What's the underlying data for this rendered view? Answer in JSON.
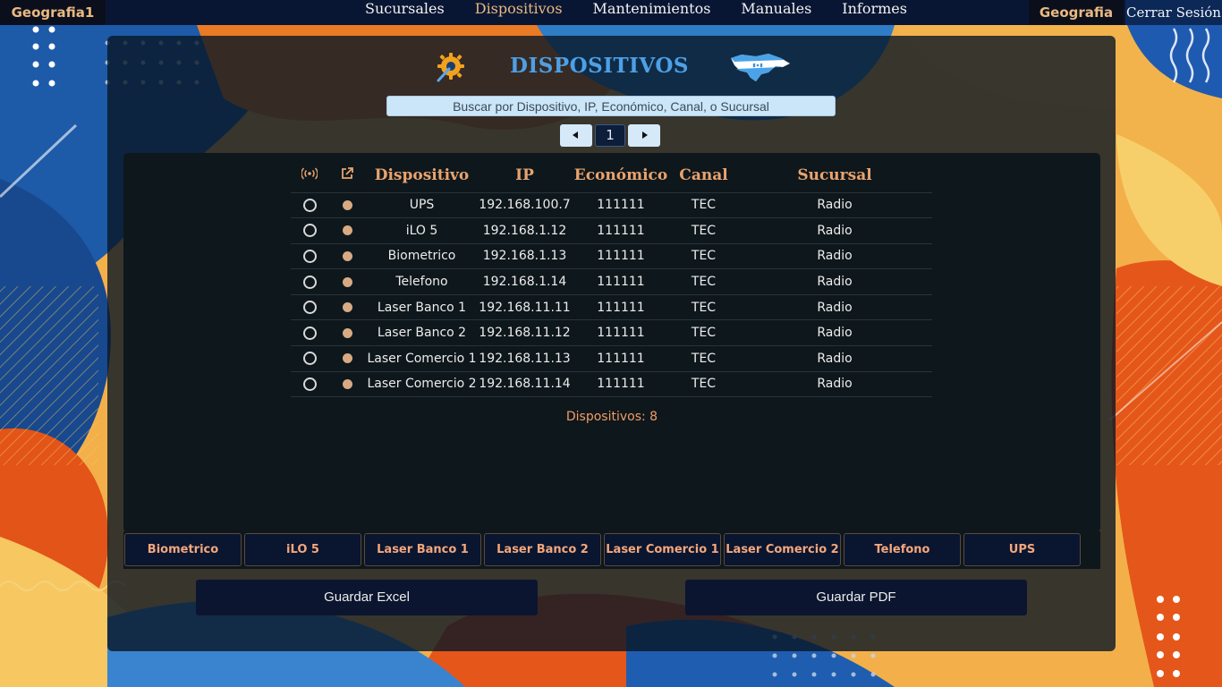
{
  "nav": {
    "brand": "Geografia1",
    "links": [
      "Sucursales",
      "Dispositivos",
      "Mantenimientos",
      "Manuales",
      "Informes"
    ],
    "active": "Dispositivos",
    "user": "Geografia",
    "logout": "Cerrar Sesión"
  },
  "header": {
    "title": "DISPOSITIVOS",
    "left_icon": "gear-icon",
    "right_icon": "flag-icon"
  },
  "search": {
    "placeholder": "Buscar por Dispositivo, IP, Económico, Canal, o Sucursal"
  },
  "pagination": {
    "current": "1"
  },
  "table": {
    "columns": [
      "Dispositivo",
      "IP",
      "Económico",
      "Canal",
      "Sucursal"
    ],
    "icon_columns": [
      "signal-icon",
      "external-link-icon"
    ],
    "rows": [
      {
        "dispositivo": "UPS",
        "ip": "192.168.100.7",
        "economico": "111111",
        "canal": "TEC",
        "sucursal": "Radio"
      },
      {
        "dispositivo": "iLO 5",
        "ip": "192.168.1.12",
        "economico": "111111",
        "canal": "TEC",
        "sucursal": "Radio"
      },
      {
        "dispositivo": "Biometrico",
        "ip": "192.168.1.13",
        "economico": "111111",
        "canal": "TEC",
        "sucursal": "Radio"
      },
      {
        "dispositivo": "Telefono",
        "ip": "192.168.1.14",
        "economico": "111111",
        "canal": "TEC",
        "sucursal": "Radio"
      },
      {
        "dispositivo": "Laser Banco 1",
        "ip": "192.168.11.11",
        "economico": "111111",
        "canal": "TEC",
        "sucursal": "Radio"
      },
      {
        "dispositivo": "Laser Banco 2",
        "ip": "192.168.11.12",
        "economico": "111111",
        "canal": "TEC",
        "sucursal": "Radio"
      },
      {
        "dispositivo": "Laser Comercio 1",
        "ip": "192.168.11.13",
        "economico": "111111",
        "canal": "TEC",
        "sucursal": "Radio"
      },
      {
        "dispositivo": "Laser Comercio 2",
        "ip": "192.168.11.14",
        "economico": "111111",
        "canal": "TEC",
        "sucursal": "Radio"
      }
    ]
  },
  "count_label": "Dispositivos: 8",
  "device_buttons": [
    "Biometrico",
    "iLO 5",
    "Laser Banco 1",
    "Laser Banco 2",
    "Laser Comercio 1",
    "Laser Comercio 2",
    "Telefono",
    "UPS"
  ],
  "actions": {
    "excel": "Guardar Excel",
    "pdf": "Guardar PDF"
  },
  "colors": {
    "accent": "#e9a36e",
    "title": "#4da0e6",
    "nav_bg": "#091633"
  }
}
